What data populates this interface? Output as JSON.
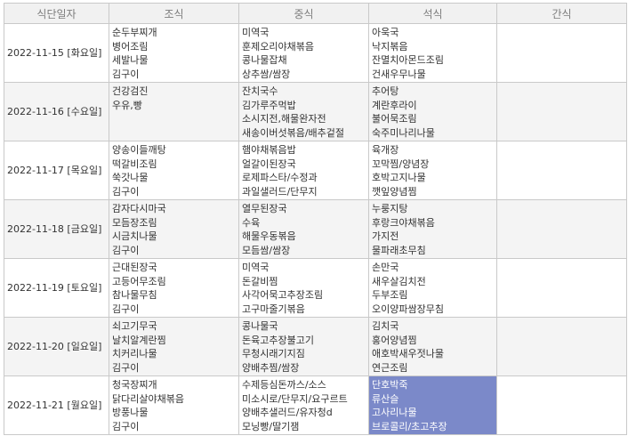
{
  "header": {
    "date": "식단일자",
    "breakfast": "조식",
    "lunch": "중식",
    "dinner": "석식",
    "snack": "간식"
  },
  "rows": [
    {
      "date": "2022-11-15 [화요일]",
      "breakfast": [
        "순두부찌개",
        "병어조림",
        "세발나물",
        "김구이"
      ],
      "lunch": [
        "미역국",
        "훈제오리야채볶음",
        "콩나물잡채",
        "상추쌈/쌈장"
      ],
      "dinner": [
        "아욱국",
        "낙지볶음",
        "잔멸치아몬드조림",
        "건새우무나물"
      ],
      "snack": []
    },
    {
      "date": "2022-11-16 [수요일]",
      "breakfast": [
        "건강검진",
        "우유,빵"
      ],
      "lunch": [
        "잔치국수",
        "김가루주먹밥",
        "소시지전,해물완자전",
        "새송이버섯볶음/배추겉절"
      ],
      "dinner": [
        "추어탕",
        "계란후라이",
        "불어묵조림",
        "숙주미나리나물"
      ],
      "snack": []
    },
    {
      "date": "2022-11-17 [목요일]",
      "breakfast": [
        "양송이들깨탕",
        "떡갈비조림",
        "쑥갓나물",
        "김구이"
      ],
      "lunch": [
        "햄야채볶음밥",
        "얼갈이된장국",
        "로제파스타/수정과",
        "과일샐러드/단무지"
      ],
      "dinner": [
        "육개장",
        "꼬막찜/양념장",
        "호박고지나물",
        "깻잎양념찜"
      ],
      "snack": []
    },
    {
      "date": "2022-11-18 [금요일]",
      "breakfast": [
        "감자다시마국",
        "모듬장조림",
        "시금치나물",
        "김구이"
      ],
      "lunch": [
        "열무된장국",
        "수육",
        "해물우동볶음",
        "모듬쌈/쌈장"
      ],
      "dinner": [
        "누룽지탕",
        "후랑크야채볶음",
        "가지전",
        "물파래초무침"
      ],
      "snack": []
    },
    {
      "date": "2022-11-19 [토요일]",
      "breakfast": [
        "근대된장국",
        "고등어무조림",
        "참나물무침",
        "김구이"
      ],
      "lunch": [
        "미역국",
        "돈갈비찜",
        "사각어묵고추장조림",
        "고구마줄기볶음"
      ],
      "dinner": [
        "손만국",
        "새우살김치전",
        "두부조림",
        "오이양파쌈장무침"
      ],
      "snack": []
    },
    {
      "date": "2022-11-20 [일요일]",
      "breakfast": [
        "쇠고기무국",
        "날치알계란찜",
        "치커리나물",
        "김구이"
      ],
      "lunch": [
        "콩나물국",
        "돈육고추장불고기",
        "무청시래기지짐",
        "양배추찜/쌈장"
      ],
      "dinner": [
        "김치국",
        "홍어양념찜",
        "애호박새우젓나물",
        "연근조림"
      ],
      "snack": []
    },
    {
      "date": "2022-11-21 [월요일]",
      "breakfast": [
        "청국장찌개",
        "닭다리살야채볶음",
        "방풍나물",
        "김구이"
      ],
      "lunch": [
        "수제등심돈까스/소스",
        "미소시로/단무지/요구르트",
        "양배추샐러드/유자청d",
        "모닝빵/딸기잼"
      ],
      "dinner": [
        "단호박죽",
        "류산슬",
        "고사리나물",
        "브로콜리/초고추장"
      ],
      "snack": []
    }
  ],
  "colors": {
    "header_bg": "#f1f1f1",
    "header_text": "#7d7d7d",
    "border": "#c9c9c9",
    "alt_row_bg": "#f4f4f4",
    "highlight_bg": "#7b89c9",
    "highlight_text": "#ffffff"
  }
}
